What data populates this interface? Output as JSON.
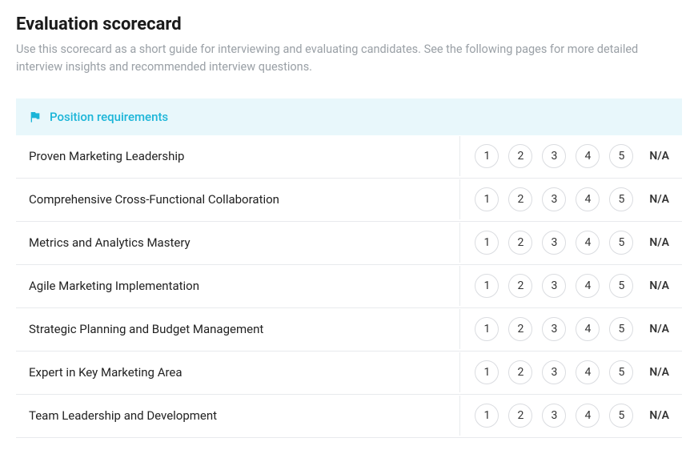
{
  "title": "Evaluation scorecard",
  "subtitle": "Use this scorecard as a short guide for interviewing and evaluating candidates. See the following pages for more detailed interview insights and recommended interview questions.",
  "section": {
    "label": "Position requirements"
  },
  "rating_options": [
    "1",
    "2",
    "3",
    "4",
    "5"
  ],
  "na_label": "N/A",
  "requirements": [
    {
      "label": "Proven Marketing Leadership"
    },
    {
      "label": "Comprehensive Cross-Functional Collaboration"
    },
    {
      "label": "Metrics and Analytics Mastery"
    },
    {
      "label": "Agile Marketing Implementation"
    },
    {
      "label": "Strategic Planning and Budget Management"
    },
    {
      "label": "Expert in Key Marketing Area"
    },
    {
      "label": "Team Leadership and Development"
    }
  ]
}
